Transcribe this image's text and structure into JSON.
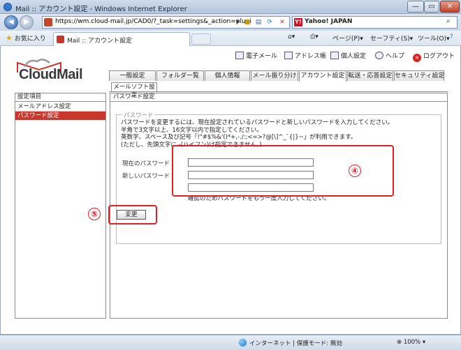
{
  "window": {
    "title": "Mail :: アカウント設定 - Windows Internet Explorer",
    "min": "—",
    "max": "▭",
    "close": "✕"
  },
  "addressbar": {
    "url": "https://wm.cloud-mail.jp/CAD0/?_task=settings&_action=plugi",
    "dropdown": "▾",
    "lock": "🔒",
    "search_label": "Yahoo! JAPAN",
    "search_icon": "search-icon"
  },
  "toolbar": {
    "favorites": "お気に入り",
    "tab_title": "Mail :: アカウント設定",
    "page": "ページ(P)",
    "safety": "セーフティ(S)",
    "tools": "ツール(O)",
    "help": "❓"
  },
  "toplinks": {
    "email": "電子メール",
    "addressbook": "アドレス帳",
    "personal": "個人設定",
    "help": "ヘルプ",
    "logout": "ログアウト"
  },
  "logo": {
    "text": "CloudMail"
  },
  "tabs": [
    "一般設定",
    "フォルダ一覧",
    "個人情報",
    "メール振り分け",
    "アカウント設定",
    "転送・応答設定",
    "セキュリティ設定"
  ],
  "active_tab": "アカウント設定",
  "subtab": "メールソフト設定",
  "sidebar": {
    "header": "設定項目",
    "items": [
      "メールアドレス設定",
      "パスワード設定"
    ],
    "selected": "パスワード設定"
  },
  "panel": {
    "header": "パスワード設定",
    "legend": "パスワード",
    "description": "パスワードを変更するには、現在設定されているパスワードと新しいパスワードを入力してください。\n半角で3文字以上、16文字以内で指定してください。\n英数字、スペース及び記号「!\"#$%&'()*+,-./:;<=>?@[\\]^_`{|}~」が利用できます。\n(ただし、先頭文字に -(ハイフン)は指定できません。)",
    "current_label": "現在のパスワード",
    "new_label": "新しいパスワード",
    "current_value": "",
    "new_value": "",
    "confirm_value": "",
    "confirm_hint": "確認のためパスワードをもう一度入力してください。",
    "submit": "変更"
  },
  "annotations": {
    "step4": "④",
    "step5": "⑤",
    "color": "#e02027"
  },
  "statusbar": {
    "zone": "インターネット | 保護モード: 無効",
    "zoom": "100%"
  }
}
